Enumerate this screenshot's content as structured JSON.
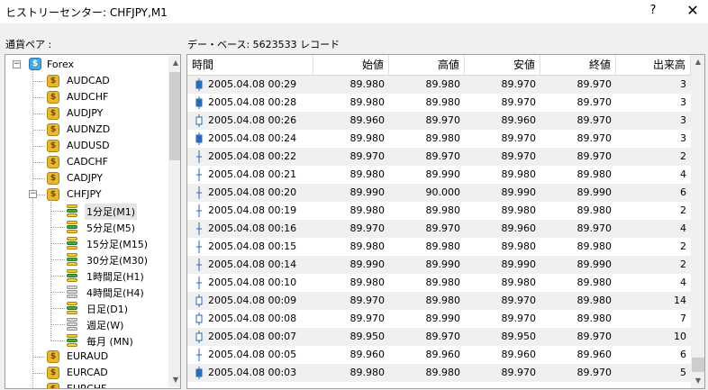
{
  "window": {
    "title": "ヒストリーセンター: CHFJPY,M1",
    "help_label": "?",
    "close_label": "✕"
  },
  "labels": {
    "pair_label": "通貨ペア :",
    "db_label": "デー・ベース: 5623533 レコード"
  },
  "tree": {
    "root": "Forex",
    "symbols_before": [
      "AUDCAD",
      "AUDCHF",
      "AUDJPY",
      "AUDNZD",
      "AUDUSD",
      "CADCHF",
      "CADJPY"
    ],
    "expanded_symbol": "CHFJPY",
    "timeframes": [
      {
        "label": "1分足(M1)",
        "active": true,
        "selected": true
      },
      {
        "label": "5分足(M5)",
        "active": true
      },
      {
        "label": "15分足(M15)",
        "active": true
      },
      {
        "label": "30分足(M30)",
        "active": true
      },
      {
        "label": "1時間足(H1)",
        "active": true
      },
      {
        "label": "4時間足(H4)",
        "active": false
      },
      {
        "label": "日足(D1)",
        "active": true
      },
      {
        "label": "週足(W)",
        "active": false
      },
      {
        "label": "毎月 (MN)",
        "active": true
      }
    ],
    "symbols_after": [
      "EURAUD",
      "EURCAD",
      "EURCHF"
    ]
  },
  "table": {
    "headers": [
      "時間",
      "始値",
      "高値",
      "安値",
      "終値",
      "出来高"
    ],
    "rows": [
      {
        "time": "2005.04.08 00:29",
        "open": "89.980",
        "high": "89.980",
        "low": "89.970",
        "close": "89.970",
        "volume": "3",
        "candle": "bear"
      },
      {
        "time": "2005.04.08 00:28",
        "open": "89.980",
        "high": "89.980",
        "low": "89.970",
        "close": "89.970",
        "volume": "3",
        "candle": "bear"
      },
      {
        "time": "2005.04.08 00:26",
        "open": "89.960",
        "high": "89.970",
        "low": "89.960",
        "close": "89.970",
        "volume": "3",
        "candle": "bull"
      },
      {
        "time": "2005.04.08 00:24",
        "open": "89.980",
        "high": "89.980",
        "low": "89.970",
        "close": "89.970",
        "volume": "3",
        "candle": "bear"
      },
      {
        "time": "2005.04.08 00:22",
        "open": "89.970",
        "high": "89.970",
        "low": "89.970",
        "close": "89.970",
        "volume": "2",
        "candle": "doji"
      },
      {
        "time": "2005.04.08 00:21",
        "open": "89.980",
        "high": "89.990",
        "low": "89.980",
        "close": "89.980",
        "volume": "4",
        "candle": "doji"
      },
      {
        "time": "2005.04.08 00:20",
        "open": "89.990",
        "high": "90.000",
        "low": "89.990",
        "close": "89.990",
        "volume": "6",
        "candle": "doji"
      },
      {
        "time": "2005.04.08 00:19",
        "open": "89.980",
        "high": "89.980",
        "low": "89.980",
        "close": "89.980",
        "volume": "2",
        "candle": "doji"
      },
      {
        "time": "2005.04.08 00:16",
        "open": "89.970",
        "high": "89.970",
        "low": "89.960",
        "close": "89.970",
        "volume": "4",
        "candle": "doji"
      },
      {
        "time": "2005.04.08 00:15",
        "open": "89.980",
        "high": "89.980",
        "low": "89.980",
        "close": "89.980",
        "volume": "2",
        "candle": "doji"
      },
      {
        "time": "2005.04.08 00:14",
        "open": "89.990",
        "high": "89.990",
        "low": "89.990",
        "close": "89.990",
        "volume": "2",
        "candle": "doji"
      },
      {
        "time": "2005.04.08 00:10",
        "open": "89.980",
        "high": "89.980",
        "low": "89.980",
        "close": "89.980",
        "volume": "4",
        "candle": "doji"
      },
      {
        "time": "2005.04.08 00:09",
        "open": "89.970",
        "high": "89.980",
        "low": "89.970",
        "close": "89.980",
        "volume": "14",
        "candle": "bull"
      },
      {
        "time": "2005.04.08 00:08",
        "open": "89.970",
        "high": "89.990",
        "low": "89.970",
        "close": "89.980",
        "volume": "7",
        "candle": "bull"
      },
      {
        "time": "2005.04.08 00:07",
        "open": "89.950",
        "high": "89.970",
        "low": "89.950",
        "close": "89.970",
        "volume": "10",
        "candle": "bull"
      },
      {
        "time": "2005.04.08 00:05",
        "open": "89.960",
        "high": "89.960",
        "low": "89.960",
        "close": "89.960",
        "volume": "6",
        "candle": "doji"
      },
      {
        "time": "2005.04.08 00:03",
        "open": "89.980",
        "high": "89.980",
        "low": "89.970",
        "close": "89.970",
        "volume": "5",
        "candle": "bear"
      }
    ]
  },
  "colors": {
    "candle": "#2a6ab8",
    "row_alt": "#f0f0f0"
  }
}
